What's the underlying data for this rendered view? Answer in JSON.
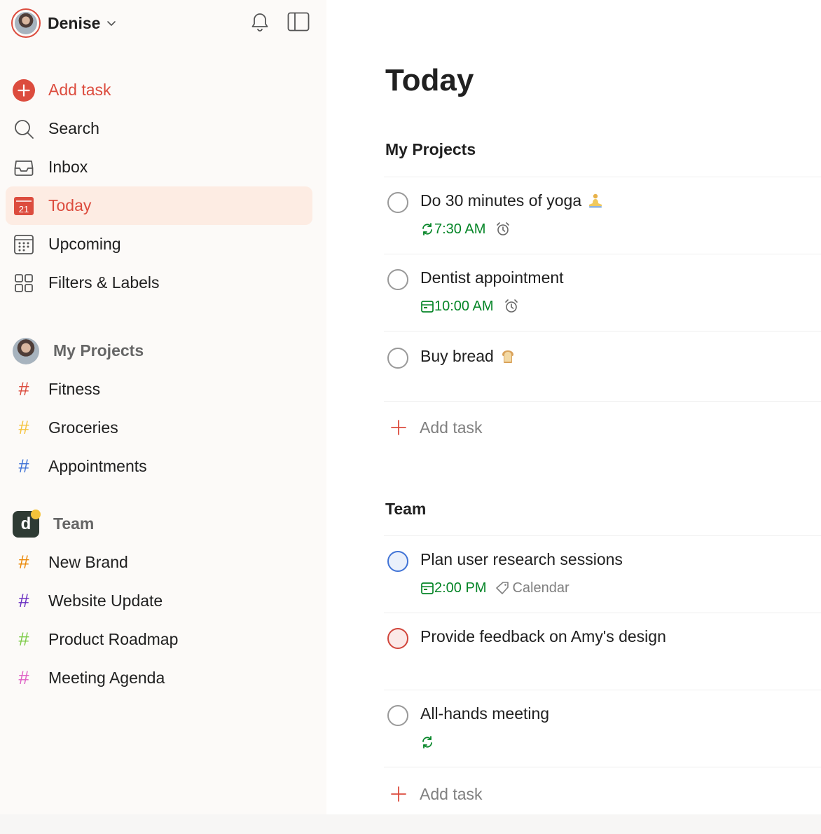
{
  "user": {
    "name": "Denise"
  },
  "nav": {
    "add_task": "Add task",
    "search": "Search",
    "inbox": "Inbox",
    "today": "Today",
    "today_date": "21",
    "upcoming": "Upcoming",
    "filters": "Filters & Labels"
  },
  "groups": {
    "my_projects": {
      "label": "My Projects",
      "projects": [
        {
          "name": "Fitness",
          "color": "#dc4c3e"
        },
        {
          "name": "Groceries",
          "color": "#f5c33b"
        },
        {
          "name": "Appointments",
          "color": "#4073d6"
        }
      ]
    },
    "team": {
      "label": "Team",
      "logo_letter": "d",
      "projects": [
        {
          "name": "New Brand",
          "color": "#eb8909"
        },
        {
          "name": "Website Update",
          "color": "#692ec2"
        },
        {
          "name": "Product Roadmap",
          "color": "#7ecc49"
        },
        {
          "name": "Meeting Agenda",
          "color": "#e05fc5"
        }
      ]
    }
  },
  "main": {
    "title": "Today",
    "sections": [
      {
        "title": "My Projects",
        "tasks": [
          {
            "title": "Do 30 minutes of yoga",
            "time": "7:30 AM",
            "icon": "recurring-icon",
            "alarm": true
          },
          {
            "title": "Dentist appointment",
            "time": "10:00 AM",
            "icon": "calendar-icon",
            "alarm": true
          },
          {
            "title": "Buy bread"
          }
        ],
        "add_label": "Add task"
      },
      {
        "title": "Team",
        "tasks": [
          {
            "title": "Plan user research sessions",
            "time": "2:00 PM",
            "icon": "calendar-icon",
            "label": "Calendar",
            "priority_color": "#4073d6"
          },
          {
            "title": "Provide feedback on Amy's design",
            "priority_color": "#d1453b"
          },
          {
            "title": "All-hands meeting",
            "icon": "recurring-icon"
          }
        ],
        "add_label": "Add task"
      }
    ]
  }
}
